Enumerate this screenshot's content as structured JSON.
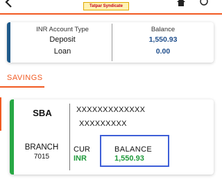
{
  "header": {
    "logo_text": "Tatpar Syndicate",
    "icons": [
      "back-icon",
      "home-icon",
      "power-icon"
    ]
  },
  "summary": {
    "left_header": "INR Account Type",
    "right_header": "Balance",
    "rows": [
      {
        "type": "Deposit",
        "balance": "1,550.93"
      },
      {
        "type": "Loan",
        "balance": "0.00"
      }
    ]
  },
  "section": {
    "title": "SAVINGS"
  },
  "account": {
    "type": "SBA",
    "number_line1": "XXXXXXXXXXXXX",
    "number_line2": "XXXXXXXXX",
    "branch_label": "BRANCH",
    "branch_code": "7015",
    "currency_label": "CUR",
    "currency": "INR",
    "balance_label": "BALANCE",
    "balance": "1,550.93"
  },
  "colors": {
    "accent_orange": "#f15a22",
    "summary_accent": "#1f5a8a",
    "account_accent": "#27a844",
    "value_blue": "#1f4e8c",
    "value_green": "#1e9a3a",
    "highlight_box": "#3e5fd8"
  }
}
